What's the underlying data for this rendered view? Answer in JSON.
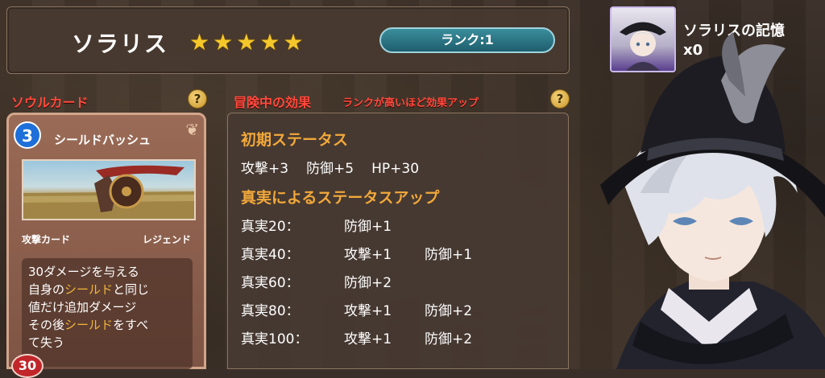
{
  "header": {
    "character_name": "ソラリス",
    "stars_filled": 5,
    "star_icon": "★",
    "rank_label": "ランク:1"
  },
  "memory": {
    "label": "ソラリスの記憶",
    "count": "x0"
  },
  "soul_card_section": {
    "title": "ソウルカード",
    "help": "?",
    "card": {
      "cost": "3",
      "name": "シールドバッシュ",
      "type": "攻撃カード",
      "rarity": "レジェンド",
      "desc_line1": "30ダメージを与える",
      "desc_line2_pre": "自身の",
      "desc_line2_hl": "シールド",
      "desc_line2_post": "と同じ",
      "desc_line3": "値だけ追加ダメージ",
      "desc_line4_pre": "その後",
      "desc_line4_hl": "シールド",
      "desc_line4_post": "をすべ",
      "desc_line5": "て失う",
      "badge": "30"
    }
  },
  "effects_section": {
    "title": "冒険中の効果",
    "subtitle": "ランクが高いほど効果アップ",
    "help": "?",
    "initial_status_heading": "初期ステータス",
    "initial_status_attack": "攻撃+3",
    "initial_status_defense": "防御+5",
    "initial_status_hp": "HP+30",
    "truth_heading": "真実によるステータスアップ",
    "truth_rows": [
      {
        "label": "真実20：",
        "a": "防御+1",
        "b": ""
      },
      {
        "label": "真実40：",
        "a": "攻撃+1",
        "b": "防御+1"
      },
      {
        "label": "真実60：",
        "a": "防御+2",
        "b": ""
      },
      {
        "label": "真実80：",
        "a": "攻撃+1",
        "b": "防御+2"
      },
      {
        "label": "真実100：",
        "a": "攻撃+1",
        "b": "防御+2"
      }
    ]
  },
  "colors": {
    "accent_red": "#ff4a3d",
    "heading_orange": "#f2a83a",
    "rank_teal": "#1f5e6e",
    "star_gold": "#f5c72a"
  }
}
